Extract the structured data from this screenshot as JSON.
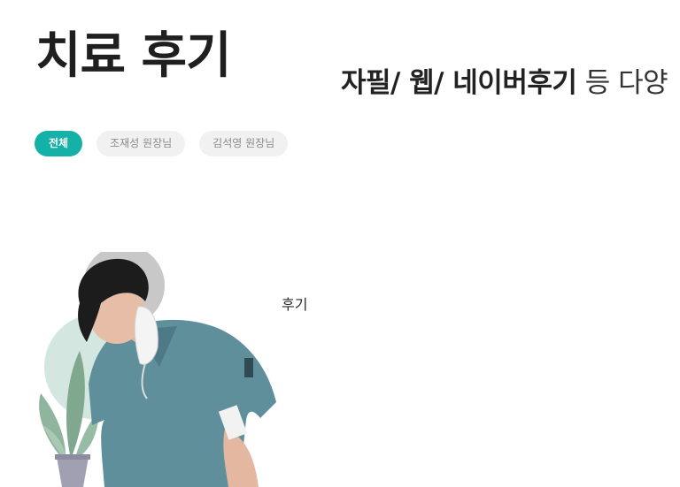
{
  "page": {
    "title": "치료 후기",
    "subtitle_strong": "자필/ 웹/ 네이버후기",
    "subtitle_light": "등 다양"
  },
  "filters": [
    {
      "label": "전체",
      "active": true
    },
    {
      "label": "조재성 원장님",
      "active": false
    },
    {
      "label": "김석영 원장님",
      "active": false
    }
  ],
  "reviews": [
    {
      "caption": "후기",
      "image_icon": "doctor-with-plant-illustration"
    }
  ],
  "colors": {
    "accent": "#14b1a9",
    "tab_inactive_bg": "#f1f1f1",
    "tab_inactive_text": "#8a8a8a",
    "scrubs": "#5f8f9b",
    "plant_circle": "#d3e6e0"
  }
}
